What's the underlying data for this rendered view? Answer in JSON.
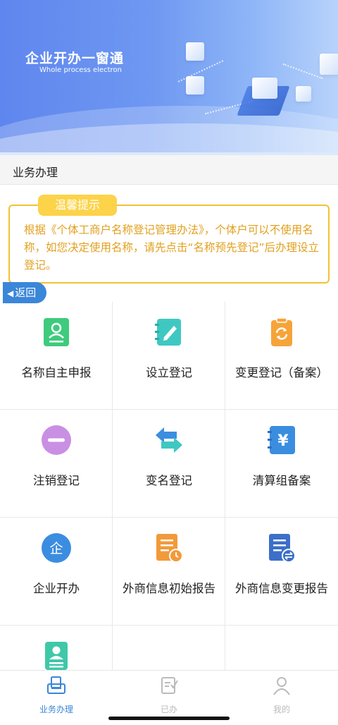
{
  "banner": {
    "title": "企业开办一窗通",
    "subtitle": "Whole process electron"
  },
  "section": {
    "title": "业务办理"
  },
  "notice": {
    "tag": "温馨提示",
    "text": "根据《个体工商户名称登记管理办法》，个体户可以不使用名称，如您决定使用名称，请先点击“名称预先登记”后办理设立登记。"
  },
  "back": {
    "label": "返回"
  },
  "grid": [
    {
      "label": "名称自主申报",
      "icon": "id-card-icon",
      "color": "#3ecb7d"
    },
    {
      "label": "设立登记",
      "icon": "notebook-edit-icon",
      "color": "#3fc8c2"
    },
    {
      "label": "变更登记（备案）",
      "icon": "clipboard-refresh-icon",
      "color": "#f6a43a"
    },
    {
      "label": "注销登记",
      "icon": "minus-circle-icon",
      "color": "#c98fe3"
    },
    {
      "label": "变名登记",
      "icon": "swap-arrows-icon",
      "color": "#3b8de0"
    },
    {
      "label": "清算组备案",
      "icon": "yen-notebook-icon",
      "color": "#3b8de0"
    },
    {
      "label": "企业开办",
      "icon": "enterprise-circle-icon",
      "color": "#3b8de0"
    },
    {
      "label": "外商信息初始报告",
      "icon": "report-clock-icon",
      "color": "#f29a3a"
    },
    {
      "label": "外商信息变更报告",
      "icon": "report-exchange-icon",
      "color": "#3b6fc9"
    },
    {
      "label": "",
      "icon": "user-stack-icon",
      "color": "#3fc8a8"
    }
  ],
  "nav": {
    "items": [
      {
        "label": "业务办理",
        "icon": "briefcase-icon",
        "active": true
      },
      {
        "label": "已办",
        "icon": "checklist-icon",
        "active": false
      },
      {
        "label": "我的",
        "icon": "user-icon",
        "active": false
      }
    ]
  },
  "colors": {
    "accent": "#3a86d9",
    "notice_border": "#f1c232",
    "notice_text": "#e2a01f"
  }
}
